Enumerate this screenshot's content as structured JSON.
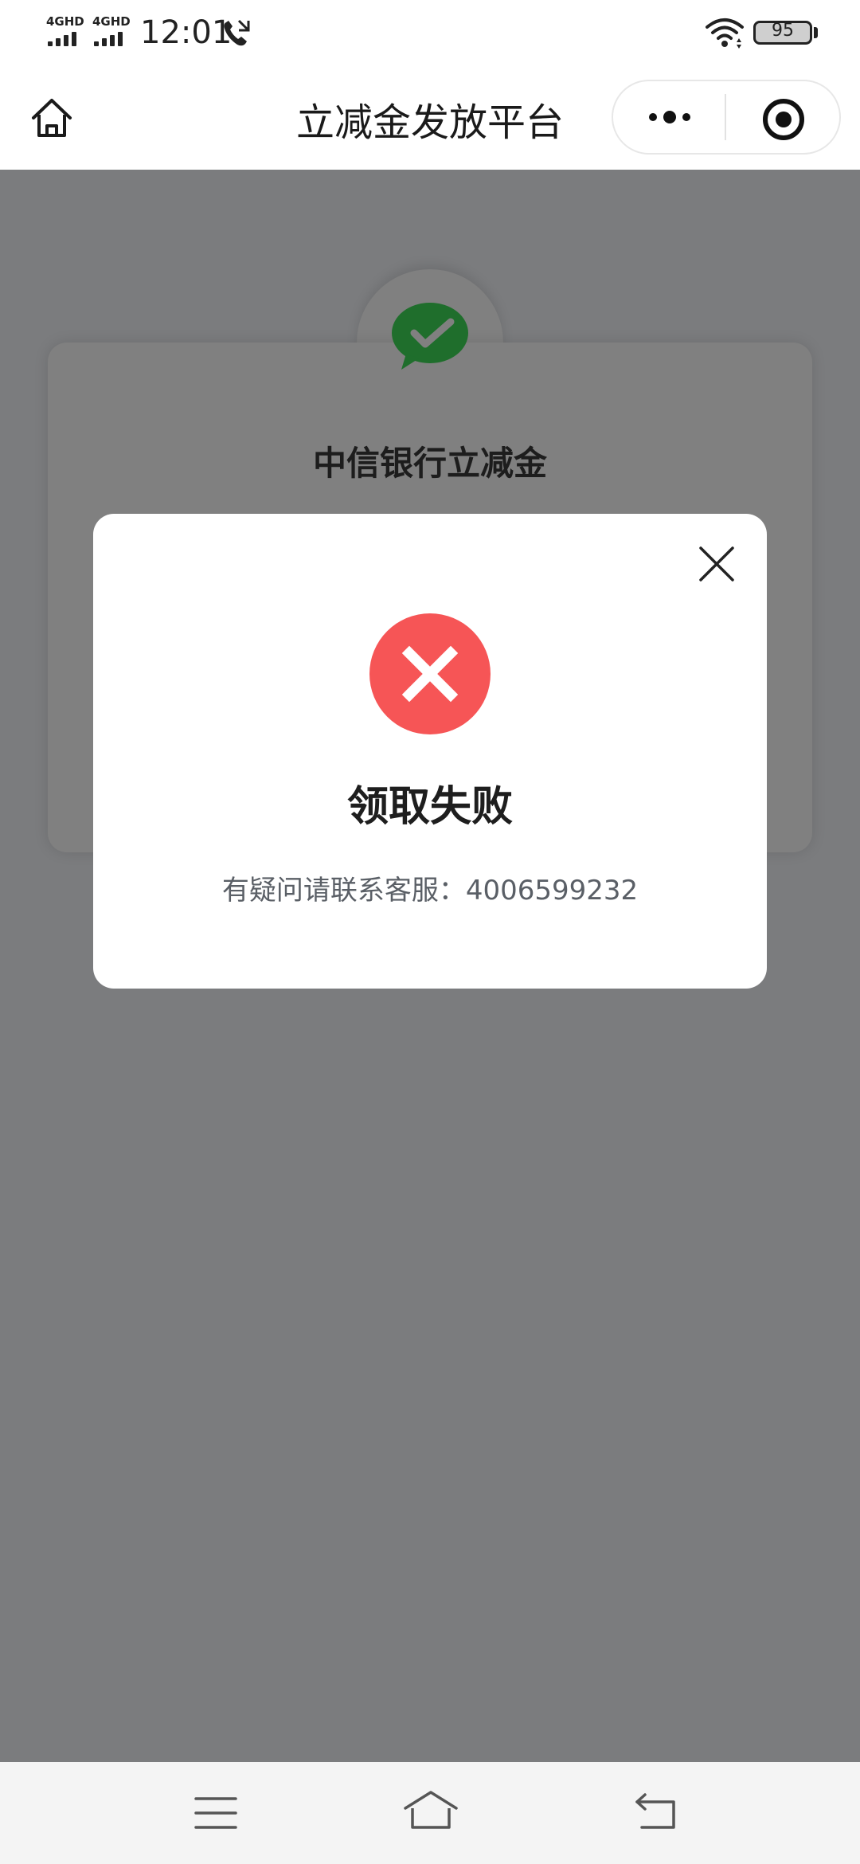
{
  "status_bar": {
    "signal_1": "4GHD",
    "signal_2": "4GHD",
    "time": "12:01",
    "battery": "95"
  },
  "nav": {
    "title": "立减金发放平台"
  },
  "card": {
    "title": "中信银行立减金"
  },
  "modal": {
    "title": "领取失败",
    "message": "有疑问请联系客服：4006599232"
  },
  "colors": {
    "overlay": "#7b7c7e",
    "error": "#f65556",
    "wechat_green": "#1f7a2e"
  },
  "icons": [
    "home-icon",
    "more-icon",
    "target-icon",
    "wechat-icon",
    "close-icon",
    "error-icon",
    "menu-icon",
    "back-icon",
    "call-icon",
    "wifi-icon"
  ]
}
